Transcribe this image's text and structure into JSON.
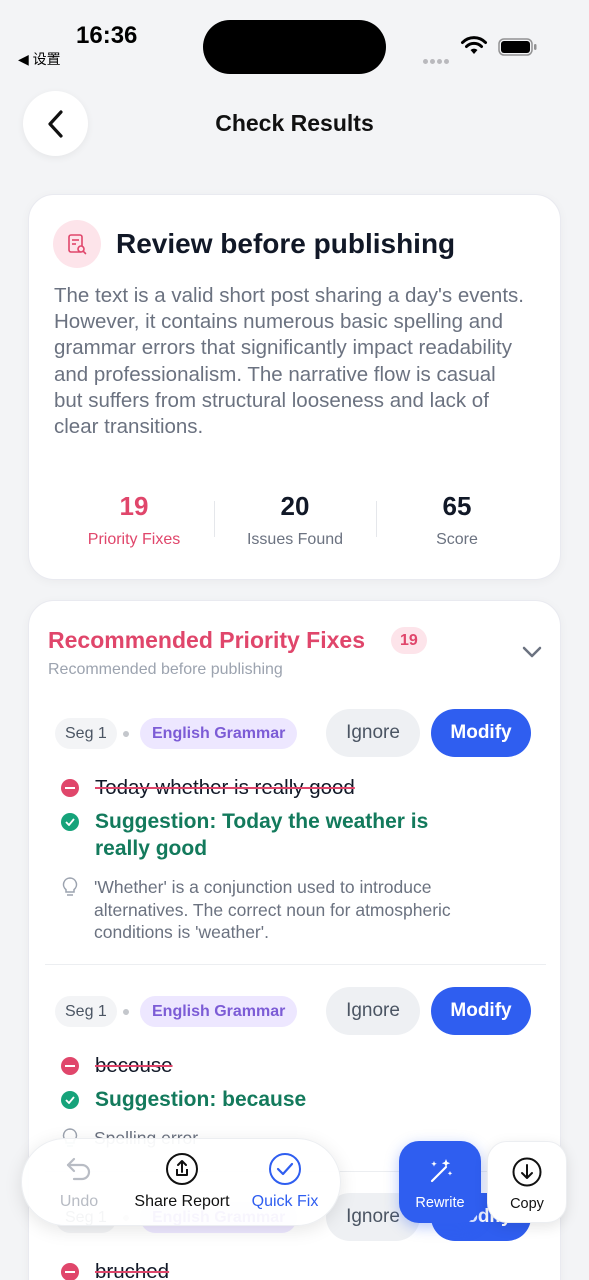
{
  "status_bar": {
    "time": "16:36",
    "back_app": "◀ 设置"
  },
  "nav": {
    "title": "Check Results"
  },
  "summary": {
    "title": "Review before publishing",
    "text": "The text is a valid short post sharing a day's events. However, it contains numerous basic spelling and grammar errors that significantly impact readability and professionalism. The narrative flow is casual but suffers from structural looseness and lack of clear transitions.",
    "stats": [
      {
        "value": "19",
        "label": "Priority Fixes"
      },
      {
        "value": "20",
        "label": "Issues Found"
      },
      {
        "value": "65",
        "label": "Score"
      }
    ]
  },
  "fixes": {
    "title": "Recommended Priority Fixes",
    "count": "19",
    "subtitle": "Recommended before publishing",
    "issues": [
      {
        "segment": "Seg 1",
        "tag": "English Grammar",
        "ignore_label": "Ignore",
        "modify_label": "Modify",
        "wrong": "Today whether is really good",
        "suggestion": "Suggestion: Today the weather is really good",
        "explanation": "'Whether' is a conjunction used to introduce alternatives. The correct noun for atmospheric conditions is 'weather'."
      },
      {
        "segment": "Seg 1",
        "tag": "English Grammar",
        "ignore_label": "Ignore",
        "modify_label": "Modify",
        "wrong": "becouse",
        "suggestion": "Suggestion: because",
        "explanation": "Spelling error"
      },
      {
        "segment": "Seg 1",
        "tag": "English Grammar",
        "ignore_label": "Ignore",
        "modify_label": "Modify",
        "wrong": "bruched"
      }
    ]
  },
  "toolbar": {
    "undo": "Undo",
    "share": "Share Report",
    "quick_fix": "Quick Fix",
    "rewrite": "Rewrite",
    "copy": "Copy"
  },
  "colors": {
    "accent": "#2f5ef0",
    "priority": "#e0466b",
    "success": "#137a5c",
    "tag": "#7c5cd6"
  }
}
